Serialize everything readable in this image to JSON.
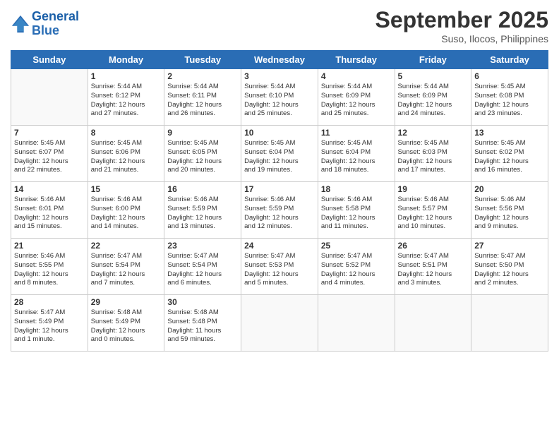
{
  "logo": {
    "line1": "General",
    "line2": "Blue"
  },
  "title": "September 2025",
  "location": "Suso, Ilocos, Philippines",
  "weekdays": [
    "Sunday",
    "Monday",
    "Tuesday",
    "Wednesday",
    "Thursday",
    "Friday",
    "Saturday"
  ],
  "weeks": [
    [
      {
        "day": "",
        "info": ""
      },
      {
        "day": "1",
        "info": "Sunrise: 5:44 AM\nSunset: 6:12 PM\nDaylight: 12 hours\nand 27 minutes."
      },
      {
        "day": "2",
        "info": "Sunrise: 5:44 AM\nSunset: 6:11 PM\nDaylight: 12 hours\nand 26 minutes."
      },
      {
        "day": "3",
        "info": "Sunrise: 5:44 AM\nSunset: 6:10 PM\nDaylight: 12 hours\nand 25 minutes."
      },
      {
        "day": "4",
        "info": "Sunrise: 5:44 AM\nSunset: 6:09 PM\nDaylight: 12 hours\nand 25 minutes."
      },
      {
        "day": "5",
        "info": "Sunrise: 5:44 AM\nSunset: 6:09 PM\nDaylight: 12 hours\nand 24 minutes."
      },
      {
        "day": "6",
        "info": "Sunrise: 5:45 AM\nSunset: 6:08 PM\nDaylight: 12 hours\nand 23 minutes."
      }
    ],
    [
      {
        "day": "7",
        "info": "Sunrise: 5:45 AM\nSunset: 6:07 PM\nDaylight: 12 hours\nand 22 minutes."
      },
      {
        "day": "8",
        "info": "Sunrise: 5:45 AM\nSunset: 6:06 PM\nDaylight: 12 hours\nand 21 minutes."
      },
      {
        "day": "9",
        "info": "Sunrise: 5:45 AM\nSunset: 6:05 PM\nDaylight: 12 hours\nand 20 minutes."
      },
      {
        "day": "10",
        "info": "Sunrise: 5:45 AM\nSunset: 6:04 PM\nDaylight: 12 hours\nand 19 minutes."
      },
      {
        "day": "11",
        "info": "Sunrise: 5:45 AM\nSunset: 6:04 PM\nDaylight: 12 hours\nand 18 minutes."
      },
      {
        "day": "12",
        "info": "Sunrise: 5:45 AM\nSunset: 6:03 PM\nDaylight: 12 hours\nand 17 minutes."
      },
      {
        "day": "13",
        "info": "Sunrise: 5:45 AM\nSunset: 6:02 PM\nDaylight: 12 hours\nand 16 minutes."
      }
    ],
    [
      {
        "day": "14",
        "info": "Sunrise: 5:46 AM\nSunset: 6:01 PM\nDaylight: 12 hours\nand 15 minutes."
      },
      {
        "day": "15",
        "info": "Sunrise: 5:46 AM\nSunset: 6:00 PM\nDaylight: 12 hours\nand 14 minutes."
      },
      {
        "day": "16",
        "info": "Sunrise: 5:46 AM\nSunset: 5:59 PM\nDaylight: 12 hours\nand 13 minutes."
      },
      {
        "day": "17",
        "info": "Sunrise: 5:46 AM\nSunset: 5:59 PM\nDaylight: 12 hours\nand 12 minutes."
      },
      {
        "day": "18",
        "info": "Sunrise: 5:46 AM\nSunset: 5:58 PM\nDaylight: 12 hours\nand 11 minutes."
      },
      {
        "day": "19",
        "info": "Sunrise: 5:46 AM\nSunset: 5:57 PM\nDaylight: 12 hours\nand 10 minutes."
      },
      {
        "day": "20",
        "info": "Sunrise: 5:46 AM\nSunset: 5:56 PM\nDaylight: 12 hours\nand 9 minutes."
      }
    ],
    [
      {
        "day": "21",
        "info": "Sunrise: 5:46 AM\nSunset: 5:55 PM\nDaylight: 12 hours\nand 8 minutes."
      },
      {
        "day": "22",
        "info": "Sunrise: 5:47 AM\nSunset: 5:54 PM\nDaylight: 12 hours\nand 7 minutes."
      },
      {
        "day": "23",
        "info": "Sunrise: 5:47 AM\nSunset: 5:54 PM\nDaylight: 12 hours\nand 6 minutes."
      },
      {
        "day": "24",
        "info": "Sunrise: 5:47 AM\nSunset: 5:53 PM\nDaylight: 12 hours\nand 5 minutes."
      },
      {
        "day": "25",
        "info": "Sunrise: 5:47 AM\nSunset: 5:52 PM\nDaylight: 12 hours\nand 4 minutes."
      },
      {
        "day": "26",
        "info": "Sunrise: 5:47 AM\nSunset: 5:51 PM\nDaylight: 12 hours\nand 3 minutes."
      },
      {
        "day": "27",
        "info": "Sunrise: 5:47 AM\nSunset: 5:50 PM\nDaylight: 12 hours\nand 2 minutes."
      }
    ],
    [
      {
        "day": "28",
        "info": "Sunrise: 5:47 AM\nSunset: 5:49 PM\nDaylight: 12 hours\nand 1 minute."
      },
      {
        "day": "29",
        "info": "Sunrise: 5:48 AM\nSunset: 5:49 PM\nDaylight: 12 hours\nand 0 minutes."
      },
      {
        "day": "30",
        "info": "Sunrise: 5:48 AM\nSunset: 5:48 PM\nDaylight: 11 hours\nand 59 minutes."
      },
      {
        "day": "",
        "info": ""
      },
      {
        "day": "",
        "info": ""
      },
      {
        "day": "",
        "info": ""
      },
      {
        "day": "",
        "info": ""
      }
    ]
  ]
}
